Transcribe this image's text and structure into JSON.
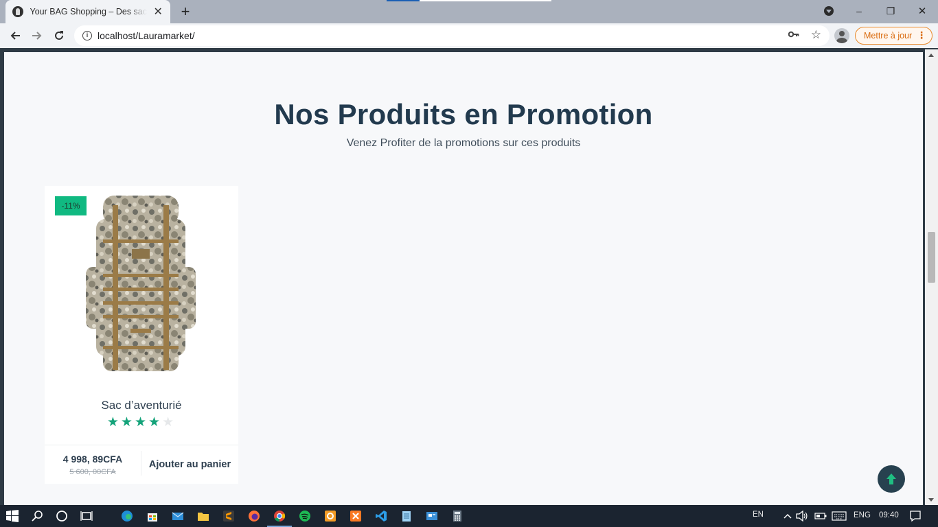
{
  "browser": {
    "tab_title": "Your BAG Shopping – Des sacs pour tous",
    "tab_close": "✕",
    "new_tab": "+",
    "url": "localhost/Lauramarket/",
    "update_label": "Mettre à jour",
    "minimize": "–",
    "restore": "❐",
    "close": "✕"
  },
  "section": {
    "title": "Nos Produits en Promotion",
    "subtitle": "Venez Profiter de la promotions sur ces produits"
  },
  "products": [
    {
      "name": "Sac d’aventurié",
      "discount": "-11%",
      "rating": 4,
      "rating_max": 5,
      "price": "4 998, 89CFA",
      "old_price": "5 600, 00CFA",
      "add_to_cart": "Ajouter au panier",
      "image_icon": "camo-backpack"
    }
  ],
  "taskbar": {
    "language": "EN",
    "keyboard": "ENG",
    "time": "09:40"
  },
  "colors": {
    "accent_green": "#10b981",
    "title_dark": "#223a4e",
    "update_orange": "#e8892b"
  }
}
